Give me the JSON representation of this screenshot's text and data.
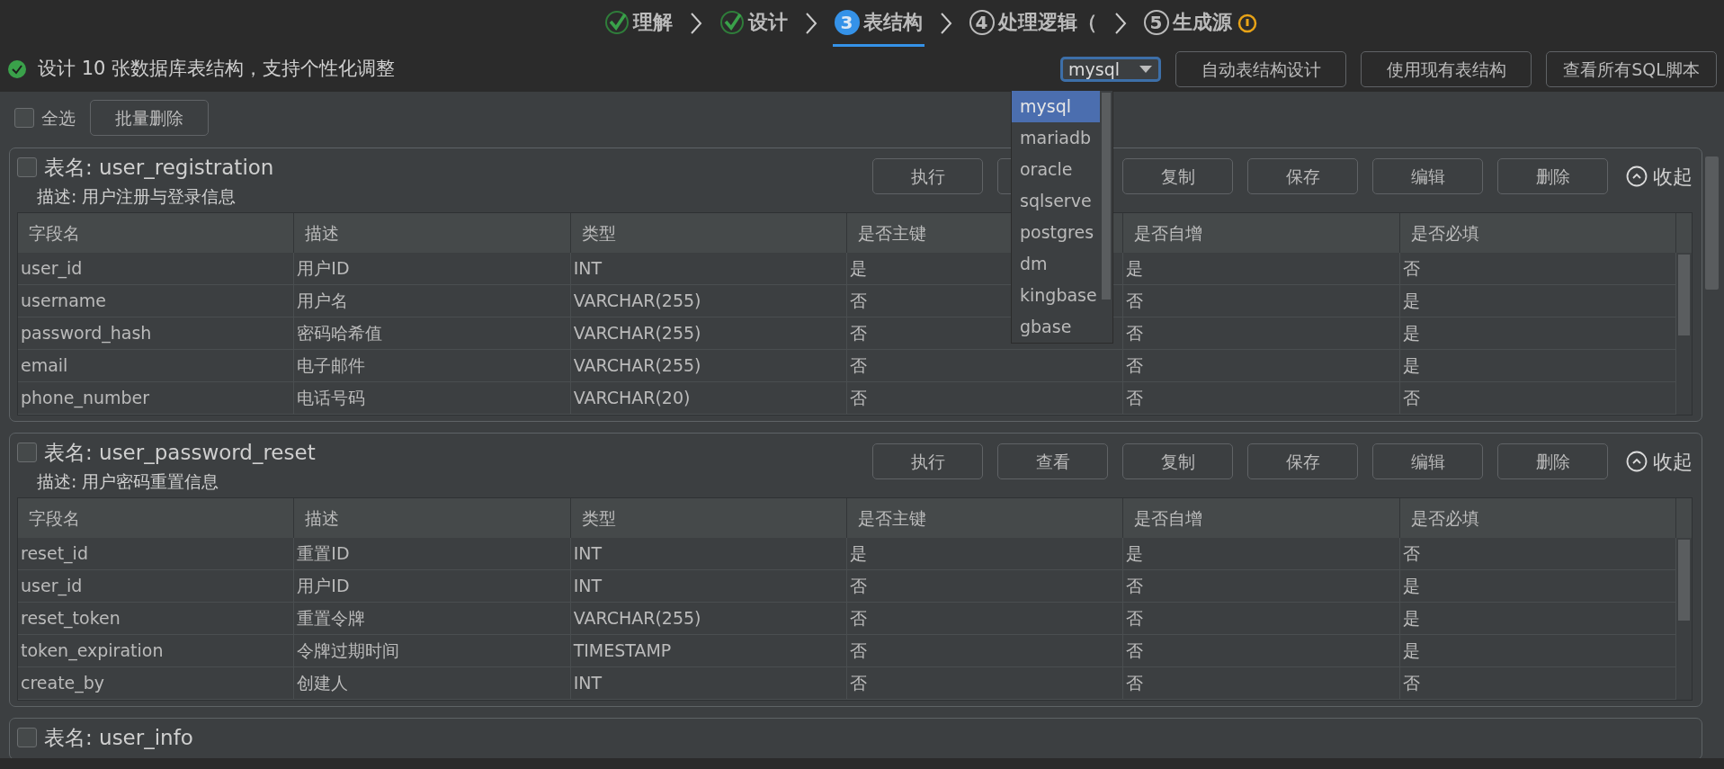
{
  "steps": [
    {
      "label": "理解",
      "kind": "done",
      "selected": false
    },
    {
      "label": "设计",
      "kind": "done",
      "selected": false
    },
    {
      "number": "3",
      "label": "表结构",
      "kind": "current",
      "selected": true
    },
    {
      "number": "4",
      "label": "处理逻辑（",
      "kind": "pending",
      "selected": false
    },
    {
      "number": "5",
      "label": "生成源",
      "kind": "pending",
      "selected": false
    }
  ],
  "status": {
    "text": "设计 10 张数据库表结构，支持个性化调整",
    "ok": true
  },
  "db_select": {
    "value": "mysql",
    "expanded": true,
    "options": [
      {
        "label": "mysql",
        "selected": true
      },
      {
        "label": "mariadb",
        "selected": false
      },
      {
        "label": "oracle",
        "selected": false
      },
      {
        "label": "sqlserve",
        "selected": false
      },
      {
        "label": "postgres",
        "selected": false
      },
      {
        "label": "dm",
        "selected": false
      },
      {
        "label": "kingbase",
        "selected": false
      },
      {
        "label": "gbase",
        "selected": false
      }
    ]
  },
  "actions": [
    "自动表结构设计",
    "使用现有表结构",
    "查看所有SQL脚本"
  ],
  "toolbar": {
    "select_all": {
      "label": "全选",
      "checked": false
    },
    "batch_delete": "批量删除"
  },
  "tables": [
    {
      "title": "表名: user_registration",
      "checked": false,
      "description": "描述: 用户注册与登录信息",
      "collapse": "收起",
      "buttons": [
        {
          "label": "执行"
        },
        {
          "covered": true
        },
        {
          "label": "复制"
        },
        {
          "label": "保存"
        },
        {
          "label": "编辑"
        },
        {
          "label": "删除"
        }
      ],
      "columns": [
        "字段名",
        "描述",
        "类型",
        "是否主键",
        "是否自增",
        "是否必填"
      ],
      "rows": [
        [
          "user_id",
          "用户ID",
          "INT",
          "是",
          "是",
          "否"
        ],
        [
          "username",
          "用户名",
          "VARCHAR(255)",
          "否",
          "否",
          "是"
        ],
        [
          "password_hash",
          "密码哈希值",
          "VARCHAR(255)",
          "否",
          "否",
          "是"
        ],
        [
          "email",
          "电子邮件",
          "VARCHAR(255)",
          "否",
          "否",
          "是"
        ],
        [
          "phone_number",
          "电话号码",
          "VARCHAR(20)",
          "否",
          "否",
          "否"
        ]
      ]
    },
    {
      "title": "表名: user_password_reset",
      "checked": false,
      "description": "描述: 用户密码重置信息",
      "collapse": "收起",
      "buttons": [
        {
          "label": "执行"
        },
        {
          "label": "查看"
        },
        {
          "label": "复制"
        },
        {
          "label": "保存"
        },
        {
          "label": "编辑"
        },
        {
          "label": "删除"
        }
      ],
      "columns": [
        "字段名",
        "描述",
        "类型",
        "是否主键",
        "是否自增",
        "是否必填"
      ],
      "rows": [
        [
          "reset_id",
          "重置ID",
          "INT",
          "是",
          "是",
          "否"
        ],
        [
          "user_id",
          "用户ID",
          "INT",
          "否",
          "否",
          "是"
        ],
        [
          "reset_token",
          "重置令牌",
          "VARCHAR(255)",
          "否",
          "否",
          "是"
        ],
        [
          "token_expiration",
          "令牌过期时间",
          "TIMESTAMP",
          "否",
          "否",
          "是"
        ],
        [
          "create_by",
          "创建人",
          "INT",
          "否",
          "否",
          "否"
        ]
      ]
    },
    {
      "title": "表名: user_info",
      "checked": false
    }
  ]
}
